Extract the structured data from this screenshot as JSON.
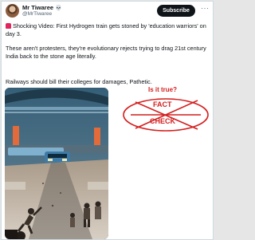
{
  "post": {
    "author_name": "Mr Tiwaree",
    "author_emoji": "💀",
    "handle": "@MrTiwaree",
    "subscribe_label": "Subscribe",
    "more_icon": "···",
    "line1": "Shocking Video: First Hydrogen train gets stoned by 'education warriors' on day 3.",
    "line2": "These aren't protesters, they're evolutionary rejects trying to drag 21st century India back to the stone age literally.",
    "line3": "Railways should bill their colleges for damages, Pathetic."
  },
  "fact_check": {
    "question": "Is it true?",
    "word_top": "FACT",
    "word_bottom": "CHECK",
    "color": "#d41f1f"
  },
  "colors": {
    "text": "#0f1419",
    "muted": "#536471",
    "button_bg": "#0f1419"
  },
  "icons": {
    "siren": "siren-icon",
    "more": "more-options-icon"
  }
}
